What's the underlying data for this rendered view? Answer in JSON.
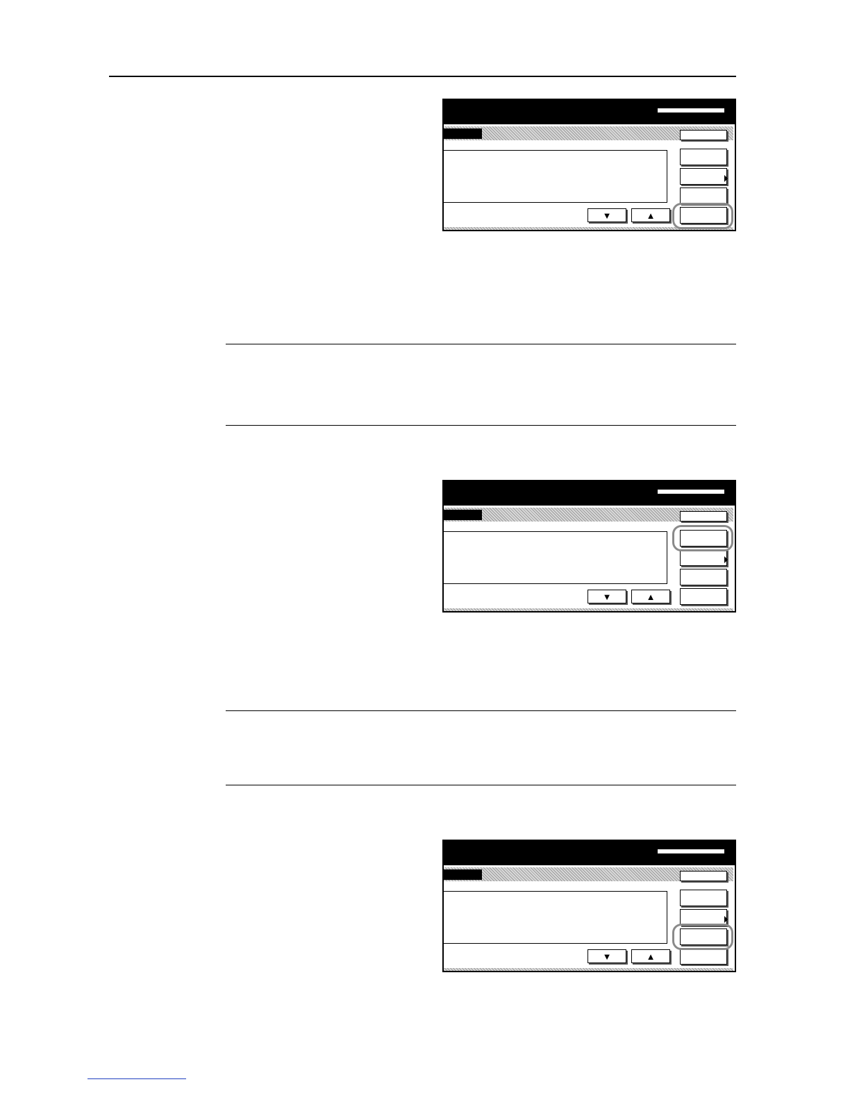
{
  "panels": [
    {
      "highlighted_button": "side-button-4",
      "arrows": {
        "down": "▼",
        "up": "▲"
      }
    },
    {
      "highlighted_button": "side-button-1",
      "arrows": {
        "down": "▼",
        "up": "▲"
      }
    },
    {
      "highlighted_button": "side-button-3",
      "arrows": {
        "down": "▼",
        "up": "▲"
      }
    }
  ],
  "colors": {
    "highlight": "#8a8a8a",
    "footer_link": "#1f3fbf"
  }
}
